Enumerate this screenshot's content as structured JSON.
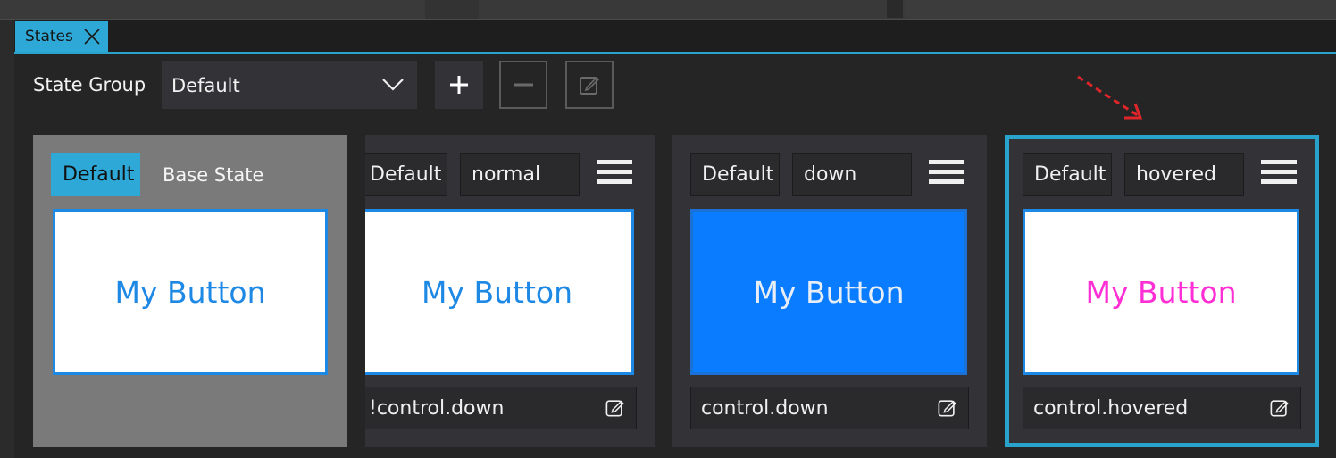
{
  "tab": {
    "label": "States",
    "close_icon": "close-icon"
  },
  "toolbar": {
    "label": "State Group",
    "group_value": "Default",
    "add_icon": "plus-icon",
    "remove_icon": "minus-icon",
    "edit_icon": "edit-icon"
  },
  "colors": {
    "accent": "#29a3cc",
    "preview_border": "#1e88e5",
    "pressed_fill": "#0a7cff",
    "hover_text": "#ff2fd5",
    "annotation_arrow": "#e0262a"
  },
  "states": [
    {
      "group": "Default",
      "name": "Base State",
      "preview_text": "My Button",
      "is_base": true
    },
    {
      "group": "Default",
      "name": "normal",
      "preview_text": "My Button",
      "condition": "!control.down"
    },
    {
      "group": "Default",
      "name": "down",
      "preview_text": "My Button",
      "condition": "control.down"
    },
    {
      "group": "Default",
      "name": "hovered",
      "preview_text": "My Button",
      "condition": "control.hovered",
      "selected": true
    }
  ]
}
